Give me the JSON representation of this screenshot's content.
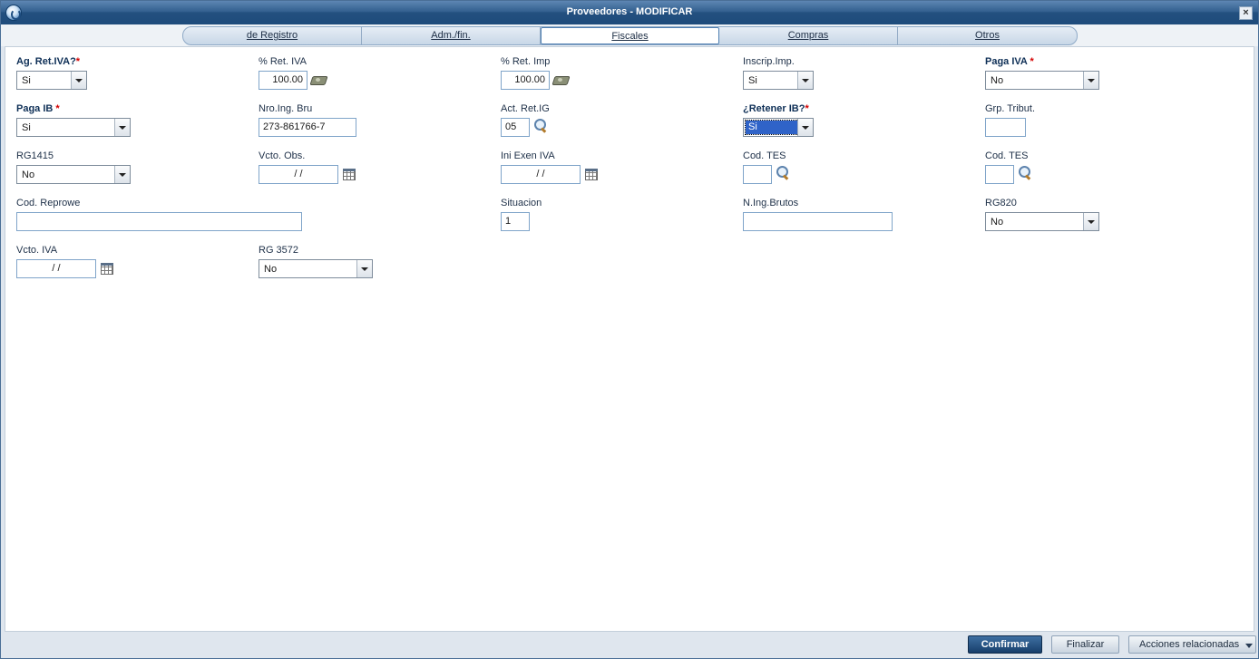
{
  "window": {
    "title": "Proveedores - MODIFICAR",
    "close_label": "×"
  },
  "tabs": [
    {
      "label": "de Registro"
    },
    {
      "label": "Adm./fin."
    },
    {
      "label": "Fiscales"
    },
    {
      "label": "Compras"
    },
    {
      "label": "Otros"
    }
  ],
  "active_tab": "Fiscales",
  "fields": {
    "ag_ret_iva": {
      "label": "Ag. Ret.IVA?",
      "required": true,
      "value": "Si"
    },
    "pct_ret_iva": {
      "label": "% Ret. IVA",
      "value": "100.00"
    },
    "pct_ret_imp": {
      "label": "% Ret. Imp",
      "value": "100.00"
    },
    "inscrip_imp": {
      "label": "Inscrip.Imp.",
      "value": "Si"
    },
    "paga_iva": {
      "label": "Paga IVA",
      "required": true,
      "value": "No"
    },
    "paga_ib": {
      "label": "Paga IB",
      "required": true,
      "value": "Si"
    },
    "nro_ing_bru": {
      "label": "Nro.Ing. Bru",
      "value": "273-861766-7"
    },
    "act_ret_ig": {
      "label": "Act. Ret.IG",
      "value": "05"
    },
    "retener_ib": {
      "label": "¿Retener IB?",
      "required": true,
      "value": "Si"
    },
    "grp_tribut": {
      "label": "Grp. Tribut.",
      "value": ""
    },
    "rg1415": {
      "label": "RG1415",
      "value": "No"
    },
    "vcto_obs": {
      "label": "Vcto. Obs.",
      "value": "/ /"
    },
    "ini_exen_iva": {
      "label": "Ini Exen IVA",
      "value": "/ /"
    },
    "cod_tes_1": {
      "label": "Cod. TES",
      "value": ""
    },
    "cod_tes_2": {
      "label": "Cod. TES",
      "value": ""
    },
    "cod_reprowe": {
      "label": "Cod. Reprowe",
      "value": ""
    },
    "situacion": {
      "label": "Situacion",
      "value": "1"
    },
    "n_ing_brutos": {
      "label": "N.Ing.Brutos",
      "value": ""
    },
    "rg820": {
      "label": "RG820",
      "value": "No"
    },
    "vcto_iva": {
      "label": "Vcto. IVA",
      "value": "/ /"
    },
    "rg3572": {
      "label": "RG 3572",
      "value": "No"
    }
  },
  "buttons": {
    "confirm": "Confirmar",
    "finish": "Finalizar",
    "related": "Acciones relacionadas"
  },
  "colors": {
    "title_bar": "#23507f",
    "primary_button": "#173f6b",
    "required_star": "#d40000"
  }
}
